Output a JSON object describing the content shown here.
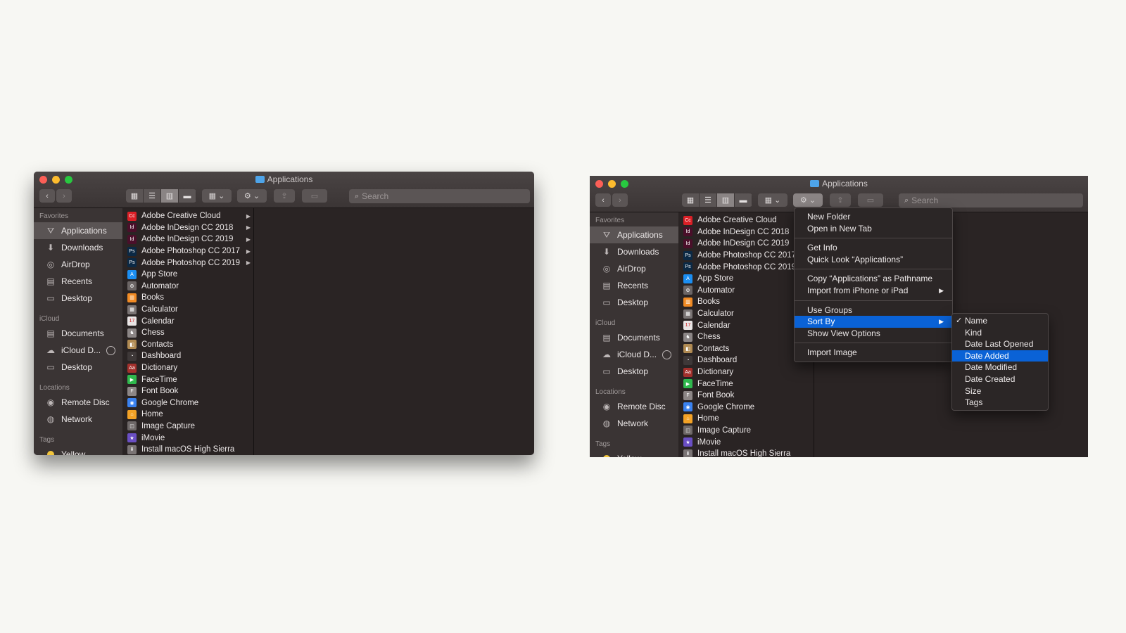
{
  "window_title": "Applications",
  "search_placeholder": "Search",
  "sidebar": {
    "favorites_label": "Favorites",
    "favorites": [
      {
        "label": "Applications",
        "icon": "applications-icon",
        "glyph": "⛛",
        "selected": true
      },
      {
        "label": "Downloads",
        "icon": "downloads-icon",
        "glyph": "⬇"
      },
      {
        "label": "AirDrop",
        "icon": "airdrop-icon",
        "glyph": "◎"
      },
      {
        "label": "Recents",
        "icon": "recents-icon",
        "glyph": "▤"
      },
      {
        "label": "Desktop",
        "icon": "desktop-icon",
        "glyph": "▭"
      }
    ],
    "icloud_label": "iCloud",
    "icloud": [
      {
        "label": "Documents",
        "icon": "documents-icon",
        "glyph": "▤"
      },
      {
        "label": "iCloud D...",
        "icon": "icloud-icon",
        "glyph": "☁"
      },
      {
        "label": "Desktop",
        "icon": "desktop-icon",
        "glyph": "▭"
      }
    ],
    "locations_label": "Locations",
    "locations": [
      {
        "label": "Remote Disc",
        "icon": "disc-icon",
        "glyph": "◉"
      },
      {
        "label": "Network",
        "icon": "network-icon",
        "glyph": "◍"
      }
    ],
    "tags_label": "Tags",
    "tags": [
      {
        "label": "Yellow",
        "icon": "yellow-tag-icon",
        "color": "#f2c53c"
      }
    ]
  },
  "files": [
    {
      "name": "Adobe Creative Cloud",
      "icon": "creative-cloud-icon",
      "color": "#da1f26",
      "glyph": "Cc",
      "folder": true
    },
    {
      "name": "Adobe InDesign CC 2018",
      "icon": "indesign-icon",
      "color": "#4a0f2a",
      "glyph": "Id",
      "folder": true
    },
    {
      "name": "Adobe InDesign CC 2019",
      "icon": "indesign-icon",
      "color": "#4a0f2a",
      "glyph": "Id",
      "folder": true
    },
    {
      "name": "Adobe Photoshop CC 2017",
      "icon": "photoshop-icon",
      "color": "#0b2945",
      "glyph": "Ps",
      "folder": true
    },
    {
      "name": "Adobe Photoshop CC 2019",
      "icon": "photoshop-icon",
      "color": "#0b2945",
      "glyph": "Ps",
      "folder": true
    },
    {
      "name": "App Store",
      "icon": "app-store-icon",
      "color": "#1b8ef2",
      "glyph": "A"
    },
    {
      "name": "Automator",
      "icon": "automator-icon",
      "color": "#6b6565",
      "glyph": "⚙"
    },
    {
      "name": "Books",
      "icon": "books-icon",
      "color": "#f08a24",
      "glyph": "▥"
    },
    {
      "name": "Calculator",
      "icon": "calculator-icon",
      "color": "#7a7474",
      "glyph": "▦"
    },
    {
      "name": "Calendar",
      "icon": "calendar-icon",
      "color": "#e9e5e5",
      "glyph": "17"
    },
    {
      "name": "Chess",
      "icon": "chess-icon",
      "color": "#8c8686",
      "glyph": "♞"
    },
    {
      "name": "Contacts",
      "icon": "contacts-icon",
      "color": "#b08a52",
      "glyph": "◧"
    },
    {
      "name": "Dashboard",
      "icon": "dashboard-icon",
      "color": "#3e3838",
      "glyph": "◔"
    },
    {
      "name": "Dictionary",
      "icon": "dictionary-icon",
      "color": "#a3302c",
      "glyph": "Aa"
    },
    {
      "name": "FaceTime",
      "icon": "facetime-icon",
      "color": "#2fb84d",
      "glyph": "▶"
    },
    {
      "name": "Font Book",
      "icon": "font-book-icon",
      "color": "#8c8686",
      "glyph": "F"
    },
    {
      "name": "Google Chrome",
      "icon": "chrome-icon",
      "color": "#3a82f0",
      "glyph": "◉"
    },
    {
      "name": "Home",
      "icon": "home-icon",
      "color": "#f3a226",
      "glyph": "⌂"
    },
    {
      "name": "Image Capture",
      "icon": "image-capture-icon",
      "color": "#6e6868",
      "glyph": "◫"
    },
    {
      "name": "iMovie",
      "icon": "imovie-icon",
      "color": "#6a4fc4",
      "glyph": "★"
    },
    {
      "name": "Install macOS High Sierra",
      "icon": "installer-icon",
      "color": "#7a7474",
      "glyph": "⬇"
    }
  ],
  "context_menu": {
    "groups": [
      [
        "New Folder",
        "Open in New Tab"
      ],
      [
        "Get Info",
        "Quick Look “Applications”"
      ],
      [
        "Copy “Applications” as Pathname",
        "Import from iPhone or iPad"
      ],
      [
        "Use Groups",
        "Sort By",
        "Show View Options"
      ],
      [
        "Import Image"
      ]
    ],
    "submenu_items": [
      "Import from iPhone or iPad",
      "Sort By"
    ],
    "highlighted": "Sort By"
  },
  "sort_submenu": {
    "items": [
      "Name",
      "Kind",
      "Date Last Opened",
      "Date Added",
      "Date Modified",
      "Date Created",
      "Size",
      "Tags"
    ],
    "checked": "Name",
    "highlighted": "Date Added"
  },
  "colors": {
    "menu_highlight": "#0a62d6",
    "window_bg": "#2a2424",
    "sidebar_bg": "#3a3434"
  }
}
